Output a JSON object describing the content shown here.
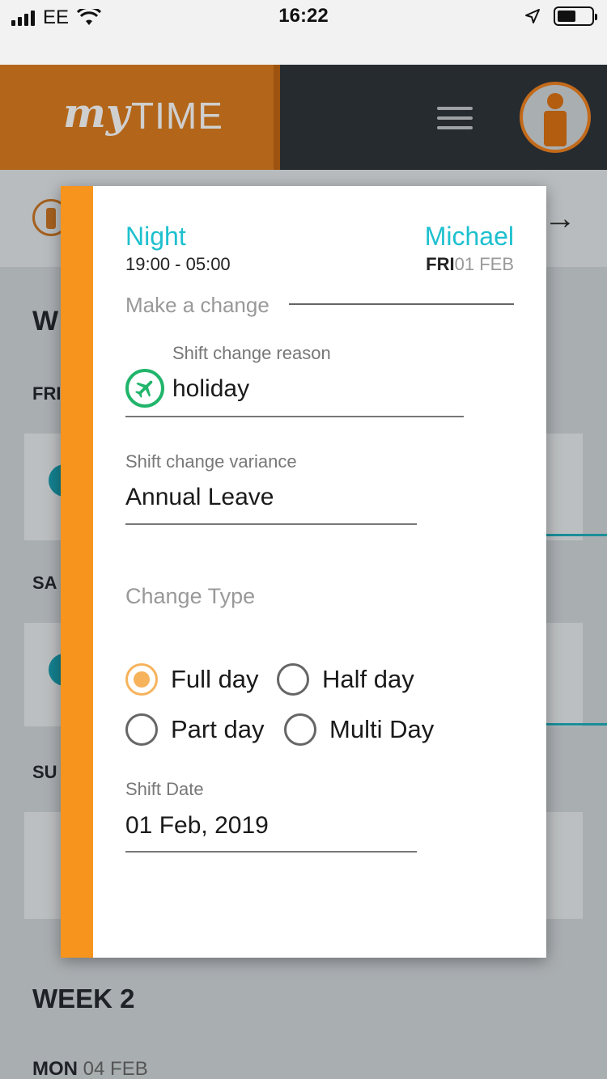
{
  "status_bar": {
    "carrier": "EE",
    "time": "16:22"
  },
  "header": {
    "brand_my": "my",
    "brand_time": "TIME"
  },
  "background": {
    "week1_label": "W",
    "fri_label": "FRI",
    "sat_label": "SA",
    "sun_label": "SU",
    "week2_label": "WEEK 2",
    "mon_label": "MON",
    "mon_date": "04 FEB"
  },
  "modal": {
    "shift_name": "Night",
    "shift_time": "19:00 - 05:00",
    "person_name": "Michael",
    "day": "FRI",
    "date": "01 FEB",
    "section_title": "Make a change",
    "reason_label": "Shift change reason",
    "reason_value": "holiday",
    "variance_label": "Shift change variance",
    "variance_value": "Annual Leave",
    "change_type_label": "Change Type",
    "options": [
      {
        "label": "Full day",
        "selected": true
      },
      {
        "label": "Half day",
        "selected": false
      },
      {
        "label": "Part day",
        "selected": false
      },
      {
        "label": "Multi Day",
        "selected": false
      }
    ],
    "shift_date_label": "Shift Date",
    "shift_date_value": "01 Feb, 2019"
  },
  "colors": {
    "accent_teal": "#1ec0cf",
    "stripe_orange": "#f7941d",
    "radio_selected": "#f6b35c",
    "holiday_green": "#21b56b"
  }
}
